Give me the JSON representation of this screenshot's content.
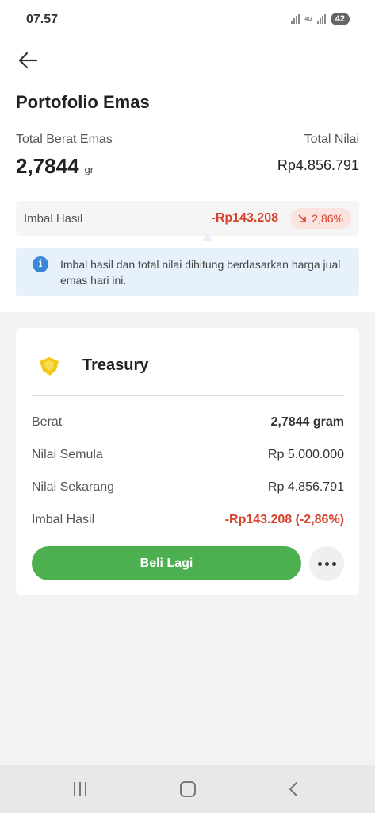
{
  "status_bar": {
    "time": "07.57",
    "network": "4G",
    "battery": "42"
  },
  "header": {
    "back_icon": "arrow-left-icon",
    "title": "Portofolio Emas"
  },
  "summary": {
    "weight_label": "Total Berat Emas",
    "weight_value": "2,7844",
    "weight_unit": "gr",
    "value_label": "Total Nilai",
    "value_amount": "Rp4.856.791"
  },
  "return_row": {
    "label": "Imbal Hasil",
    "amount": "-Rp143.208",
    "percent": "2,86%",
    "trend_icon": "arrow-down-right-icon"
  },
  "info_note": {
    "icon": "info-icon",
    "text": "Imbal hasil dan total nilai dihitung berdasarkan harga jual emas hari ini."
  },
  "product_card": {
    "logo_icon": "treasury-logo-icon",
    "title": "Treasury",
    "rows": [
      {
        "label": "Berat",
        "value": "2,7844 gram"
      },
      {
        "label": "Nilai Semula",
        "value": "Rp 5.000.000"
      },
      {
        "label": "Nilai Sekarang",
        "value": "Rp 4.856.791"
      },
      {
        "label": "Imbal Hasil",
        "value": "-Rp143.208 (-2,86%)"
      }
    ],
    "buy_button": "Beli Lagi",
    "more_icon": "more-horizontal-icon"
  },
  "colors": {
    "accent_green": "#4caf50",
    "negative_red": "#d9412c",
    "info_blue": "#3a86d8",
    "info_bg": "#e6f1fb",
    "logo_yellow": "#f2c918"
  },
  "nav_bar": {
    "recent_icon": "recent-apps-icon",
    "home_icon": "home-icon",
    "back_icon": "back-chevron-icon"
  }
}
